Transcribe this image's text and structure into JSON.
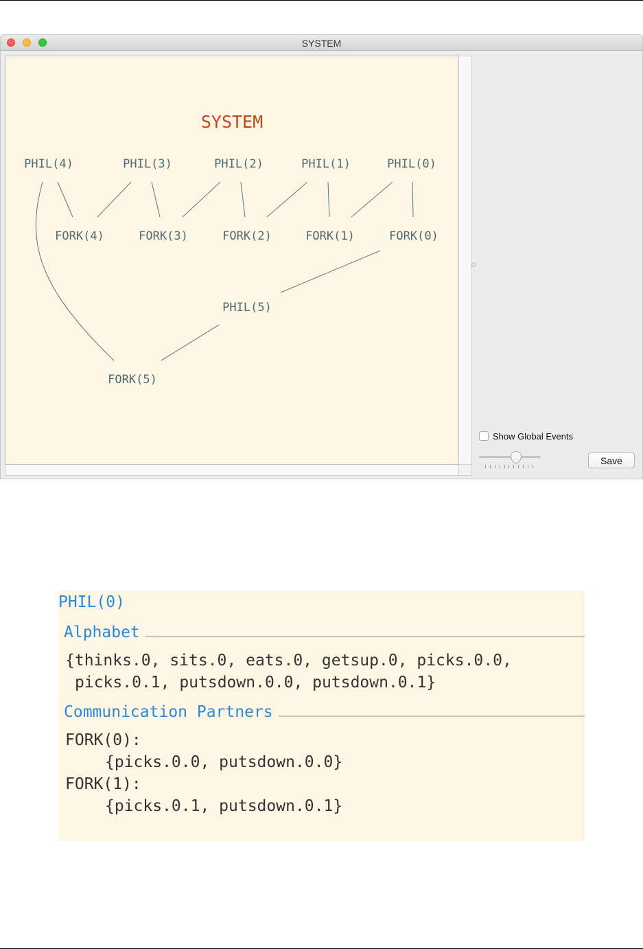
{
  "window": {
    "title": "SYSTEM",
    "diagram": {
      "title": "SYSTEM",
      "title_color": "#c4471b",
      "node_color": "#4f6b72",
      "edge_color": "#6b7d80",
      "nodes": [
        "PHIL(4)",
        "PHIL(3)",
        "PHIL(2)",
        "PHIL(1)",
        "PHIL(0)",
        "FORK(4)",
        "FORK(3)",
        "FORK(2)",
        "FORK(1)",
        "FORK(0)",
        "PHIL(5)",
        "FORK(5)"
      ],
      "edges": [
        [
          "PHIL(4)",
          "FORK(4)"
        ],
        [
          "PHIL(4)",
          "FORK(5)"
        ],
        [
          "PHIL(3)",
          "FORK(4)"
        ],
        [
          "PHIL(3)",
          "FORK(3)"
        ],
        [
          "PHIL(2)",
          "FORK(3)"
        ],
        [
          "PHIL(2)",
          "FORK(2)"
        ],
        [
          "PHIL(1)",
          "FORK(2)"
        ],
        [
          "PHIL(1)",
          "FORK(1)"
        ],
        [
          "PHIL(0)",
          "FORK(1)"
        ],
        [
          "PHIL(0)",
          "FORK(0)"
        ],
        [
          "PHIL(5)",
          "FORK(0)"
        ],
        [
          "PHIL(5)",
          "FORK(5)"
        ]
      ]
    },
    "controls": {
      "show_global_events_label": "Show Global Events",
      "show_global_events_checked": false,
      "save_label": "Save"
    }
  },
  "info": {
    "process": "PHIL(0)",
    "alphabet_heading": "Alphabet",
    "alphabet_lines": [
      "{thinks.0, sits.0, eats.0, getsup.0, picks.0.0,",
      " picks.0.1, putsdown.0.0, putsdown.0.1}"
    ],
    "partners_heading": "Communication Partners",
    "partners": [
      {
        "name": "FORK(0):",
        "events": "{picks.0.0, putsdown.0.0}"
      },
      {
        "name": "FORK(1):",
        "events": "{picks.0.1, putsdown.0.1}"
      }
    ],
    "accent_color": "#2b8ad6"
  }
}
